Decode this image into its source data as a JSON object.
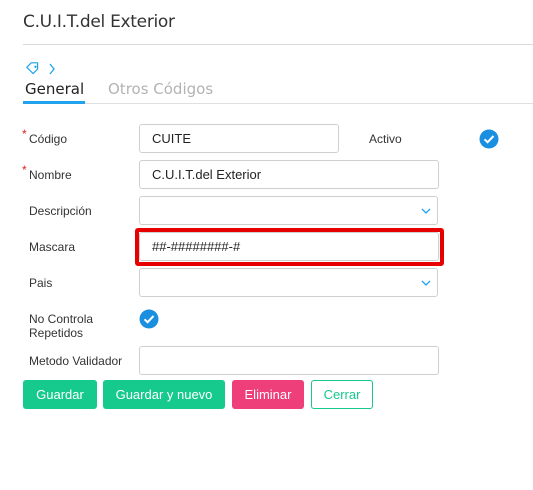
{
  "window": {
    "title": "C.U.I.T.del Exterior"
  },
  "breadcrumb": {
    "icon": "tag-icon",
    "separator_icon": "chevron-right-icon"
  },
  "tabs": [
    {
      "label": "General",
      "active": true
    },
    {
      "label": "Otros Códigos",
      "active": false
    }
  ],
  "form": {
    "required_mark": "*",
    "codigo": {
      "label": "Código",
      "value": "CUITE",
      "required": true
    },
    "activo": {
      "label": "Activo",
      "checked": true
    },
    "nombre": {
      "label": "Nombre",
      "value": "C.U.I.T.del Exterior",
      "required": true
    },
    "descripcion": {
      "label": "Descripción",
      "value": ""
    },
    "mascara": {
      "label": "Mascara",
      "value": "##-########-#"
    },
    "pais": {
      "label": "Pais",
      "value": ""
    },
    "no_controla_repetidos": {
      "label_line1": "No Controla",
      "label_line2": "Repetidos",
      "checked": true
    },
    "metodo_validador": {
      "label": "Metodo Validador",
      "value": ""
    }
  },
  "buttons": {
    "guardar": "Guardar",
    "guardar_y_nuevo": "Guardar y nuevo",
    "eliminar": "Eliminar",
    "cerrar": "Cerrar"
  },
  "colors": {
    "accent": "#1fa3ec",
    "primary_button": "#16c98d",
    "danger_button": "#ef3f7a",
    "highlight": "#e60000"
  }
}
